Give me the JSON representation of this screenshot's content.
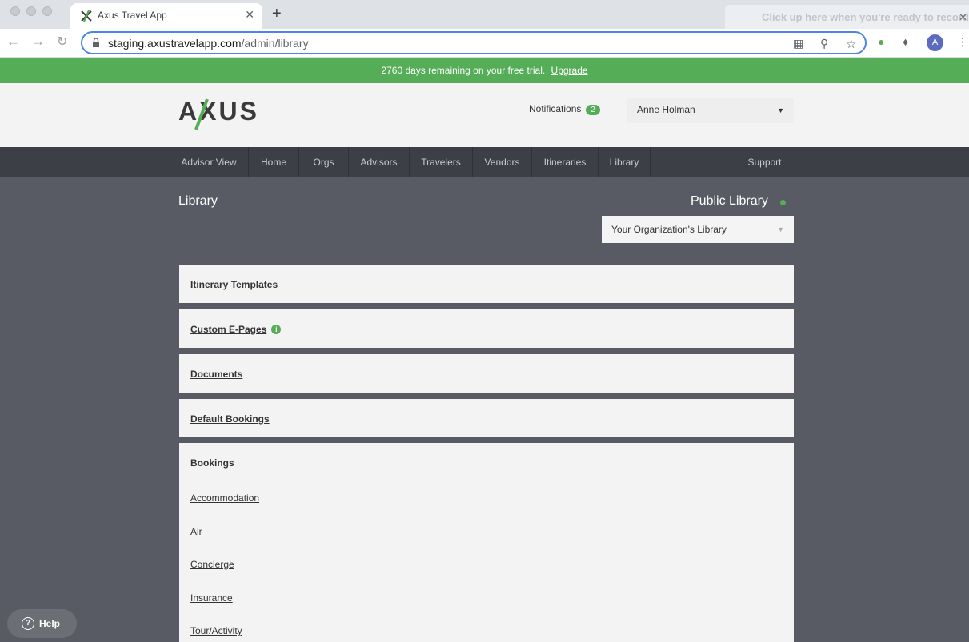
{
  "browser": {
    "tab_title": "Axus Travel App",
    "tab_close": "✕",
    "new_tab": "+",
    "recording_banner": "Click up here when you're ready to record",
    "recording_close": "✕",
    "url_host": "staging.axustravelapp.com",
    "url_path": "/admin/library",
    "profile_initial": "A",
    "icons": [
      "back-icon",
      "forward-icon",
      "reload-icon",
      "lock-icon",
      "qr-icon",
      "zoom-icon",
      "star-icon",
      "extension-icon",
      "puzzle-icon",
      "menu-icon"
    ]
  },
  "trial": {
    "message": "2760 days remaining on your free trial.",
    "upgrade_link": "Upgrade",
    "color": "#55ad57"
  },
  "header": {
    "logo_text": "AXUS",
    "notifications_label": "Notifications",
    "notifications_count": "2",
    "user_name": "Anne Holman"
  },
  "nav": {
    "items": [
      "Advisor View",
      "Home",
      "Orgs",
      "Advisors",
      "Travelers",
      "Vendors",
      "Itineraries",
      "Library"
    ],
    "support": "Support"
  },
  "main": {
    "title": "Library",
    "public_library": "Public Library",
    "library_select": "Your Organization's Library",
    "panels": [
      "Itinerary Templates",
      "Custom E-Pages",
      "Documents",
      "Default Bookings"
    ],
    "bookings_title": "Bookings",
    "booking_items": [
      "Accommodation",
      "Air",
      "Concierge",
      "Insurance",
      "Tour/Activity"
    ]
  },
  "help": {
    "label": "Help"
  }
}
